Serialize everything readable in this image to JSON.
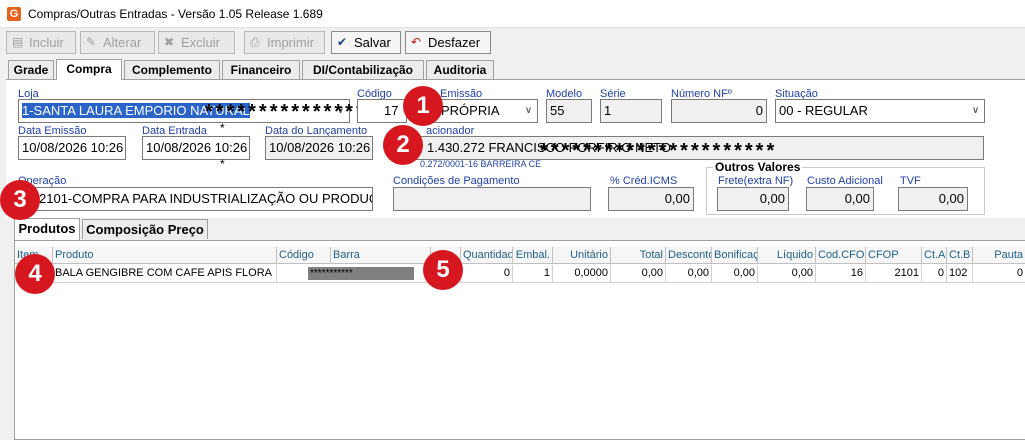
{
  "window": {
    "title": "Compras/Outras Entradas - Versão 1.05 Release 1.689",
    "app_icon": "G"
  },
  "toolbar": {
    "incluir": "Incluir",
    "alterar": "Alterar",
    "excluir": "Excluir",
    "imprimir": "Imprimir",
    "salvar": "Salvar",
    "desfazer": "Desfazer"
  },
  "tabs": [
    "Grade",
    "Compra",
    "Complemento",
    "Financeiro",
    "DI/Contabilização",
    "Auditoria"
  ],
  "form": {
    "loja_label": "Loja",
    "loja_value": "1-SANTA LAURA EMPORIO NATURAL",
    "codigo_label": "Código",
    "codigo_value": "17",
    "emissao_label": "Emissão",
    "emissao_value": "PRÓPRIA",
    "modelo_label": "Modelo",
    "modelo_value": "55",
    "serie_label": "Série",
    "serie_value": "1",
    "numero_nf_label": "Número NFº",
    "numero_nf_value": "0",
    "situacao_label": "Situação",
    "situacao_value": "00 - REGULAR",
    "data_emissao_label": "Data Emissão",
    "data_emissao_value": "10/08/2026 10:26",
    "data_entrada_label": "Data Entrada",
    "data_entrada_value": "10/08/2026 10:26",
    "data_lancamento_label": "Data do Lançamento",
    "data_lancamento_value": "10/08/2026 10:26",
    "relacionador_label": "acionador",
    "relacionador_value": "1.430.272 FRANCISCO PORFIRIO NETO",
    "relacionador_sub": "0.272/0001-16   BARREIRA CE",
    "operacao_label": "Operação",
    "operacao_value": "2101-COMPRA PARA INDUSTRIALIZAÇÃO OU PRODUÇ",
    "condicoes_label": "Condições de Pagamento",
    "condicoes_value": "",
    "cred_icms_label": "% Créd.ICMS",
    "cred_icms_value": "0,00",
    "outros_valores_title": "Outros Valores",
    "frete_label": "Frete(extra NF)",
    "frete_value": "0,00",
    "custo_label": "Custo Adicional",
    "custo_value": "0,00",
    "tvf_label": "TVF",
    "tvf_value": "0,00",
    "mask": "**********************"
  },
  "badges": [
    "1",
    "2",
    "3",
    "4",
    "5"
  ],
  "subtabs": [
    "Produtos",
    "Composição Preço"
  ],
  "grid": {
    "headers": [
      "Item",
      "Produto",
      "Código",
      "Barra",
      "",
      "Quantidade",
      "Embal.",
      "Unitário",
      "Total",
      "Desconto",
      "Bonificação",
      "Líquido",
      "Cod.CFOP",
      "CFOP",
      "Ct.A",
      "Ct.B",
      "Pauta"
    ],
    "rows": [
      {
        "produto": "BALA GENGIBRE  COM CAFE APIS FLORA",
        "barra": "***********",
        "quantidade": "0",
        "embal": "1",
        "unitario": "0,0000",
        "total": "0,00",
        "desconto": "0,00",
        "bonificacao": "0,00",
        "liquido": "0,00",
        "cod_cfop": "16",
        "cfop": "2101",
        "cta": "0",
        "ctb": "102",
        "pauta": "0"
      }
    ]
  }
}
